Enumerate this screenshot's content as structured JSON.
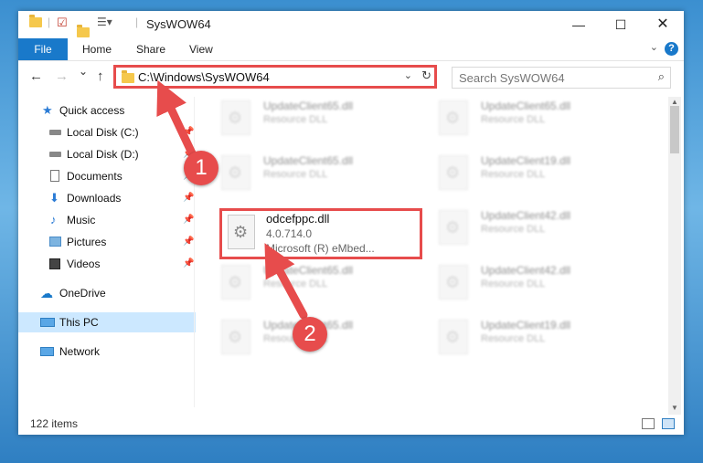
{
  "window": {
    "title": "SysWOW64"
  },
  "ribbon": {
    "file": "File",
    "home": "Home",
    "share": "Share",
    "view": "View",
    "help": "?"
  },
  "nav": {
    "back": "←",
    "forward": "→",
    "recent": "⌄",
    "up": "↑",
    "address": "C:\\Windows\\SysWOW64",
    "search_placeholder": "Search SysWOW64"
  },
  "sidebar": {
    "items": [
      {
        "label": "Quick access",
        "icon": "star-icon"
      },
      {
        "label": "Local Disk (C:)",
        "icon": "drive-icon",
        "pinned": true
      },
      {
        "label": "Local Disk (D:)",
        "icon": "drive-icon",
        "pinned": true
      },
      {
        "label": "Documents",
        "icon": "documents-icon",
        "pinned": true
      },
      {
        "label": "Downloads",
        "icon": "downloads-icon",
        "pinned": true
      },
      {
        "label": "Music",
        "icon": "music-icon",
        "pinned": true
      },
      {
        "label": "Pictures",
        "icon": "pictures-icon",
        "pinned": true
      },
      {
        "label": "Videos",
        "icon": "videos-icon",
        "pinned": true
      },
      {
        "label": "OneDrive",
        "icon": "cloud-icon"
      },
      {
        "label": "This PC",
        "icon": "computer-icon",
        "selected": true
      },
      {
        "label": "Network",
        "icon": "network-icon"
      }
    ]
  },
  "files": {
    "left": [
      {
        "name": "UpdateClient65.dll",
        "desc": "Resource DLL"
      },
      {
        "name": "UpdateClient65.dll",
        "desc": "Resource DLL"
      },
      {
        "name": "UpdateClient65.dll",
        "desc": "Resource DLL"
      },
      {
        "name": "UpdateClient65.dll",
        "desc": "Resource DLL"
      }
    ],
    "right": [
      {
        "name": "UpdateClient65.dll",
        "desc": "Resource DLL"
      },
      {
        "name": "UpdateClient19.dll",
        "desc": "Resource DLL"
      },
      {
        "name": "UpdateClient42.dll",
        "desc": "Resource DLL"
      },
      {
        "name": "UpdateClient42.dll",
        "desc": "Resource DLL"
      },
      {
        "name": "UpdateClient19.dll",
        "desc": "Resource DLL"
      }
    ],
    "focus": {
      "name": "odcefppc.dll",
      "version": "4.0.714.0",
      "desc": "Microsoft (R) eMbed..."
    }
  },
  "status": {
    "count": "122 items"
  },
  "annotations": {
    "step1": "1",
    "step2": "2"
  },
  "colors": {
    "accent": "#1979ca",
    "highlight": "#e74c4c",
    "selected": "#cce8ff"
  }
}
